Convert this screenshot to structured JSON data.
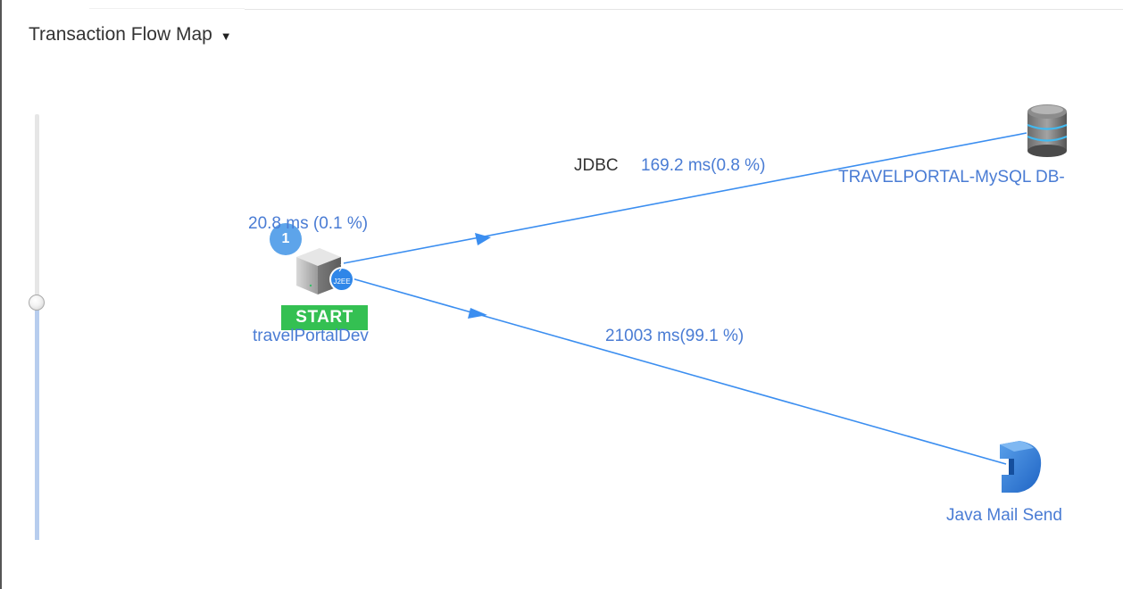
{
  "header": {
    "title": "Transaction Flow Map",
    "caret_icon": "caret-down-icon"
  },
  "zoom": {
    "level": 0.56
  },
  "colors": {
    "edge": "#3b8ef0",
    "label": "#4a7cd4",
    "start": "#34c052",
    "badge": "#5da4ea"
  },
  "nodes": {
    "start": {
      "name": "travelPortalDev",
      "badge": "START",
      "count": "1",
      "time": "20.8 ms (0.1 %)",
      "icon": "server-icon",
      "sub_icon": "java-icon"
    },
    "db": {
      "name": "TRAVELPORTAL-MySQL DB-",
      "icon": "database-icon"
    },
    "mail": {
      "name": "Java Mail Send",
      "icon": "mail-plug-icon"
    }
  },
  "edges": {
    "jdbc": {
      "protocol": "JDBC",
      "time": "169.2 ms(0.8 %)"
    },
    "mail": {
      "time": "21003 ms(99.1 %)"
    }
  }
}
